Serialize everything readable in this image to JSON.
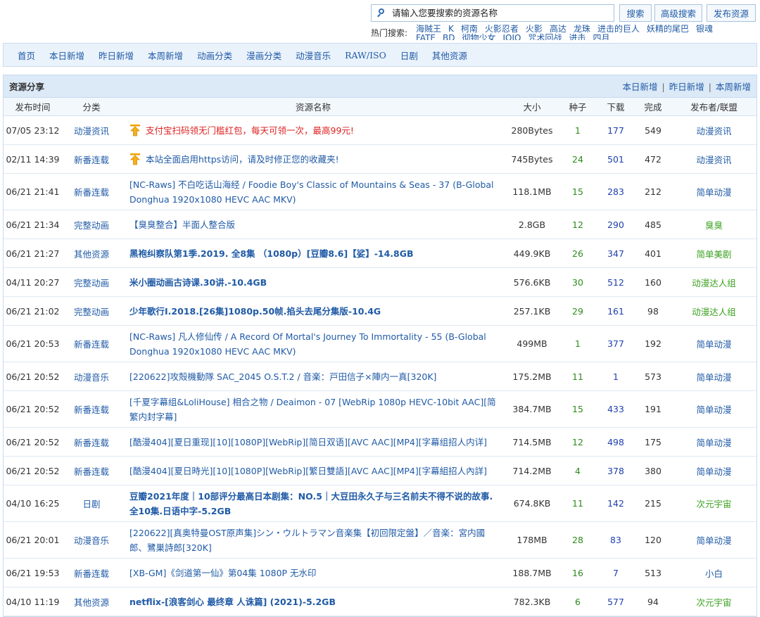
{
  "search": {
    "placeholder": "请输入您要搜索的资源名称",
    "search_btn": "搜索",
    "advanced_btn": "高级搜索",
    "publish_btn": "发布资源"
  },
  "hot": {
    "label": "热门搜索:",
    "keywords": [
      "海贼王",
      "K",
      "柯南",
      "火影忍者",
      "火影",
      "高达",
      "龙珠",
      "进击的巨人",
      "妖精的尾巴",
      "银魂",
      "FATE",
      "BD",
      "彻物少女",
      "JOJO",
      "咒术回战",
      "进击",
      "四月"
    ]
  },
  "nav": {
    "items": [
      "首页",
      "本日新增",
      "昨日新增",
      "本周新增",
      "动画分类",
      "漫画分类",
      "动漫音乐",
      "RAW/ISO",
      "日剧",
      "其他资源"
    ]
  },
  "panel": {
    "title": "资源分享",
    "links": [
      "本日新增",
      "昨日新增",
      "本周新增"
    ],
    "separator": "|",
    "columns": [
      "发布时间",
      "分类",
      "资源名称",
      "大小",
      "种子",
      "下载",
      "完成",
      "发布者/联盟"
    ],
    "rows": [
      {
        "date": "07/05 23:12",
        "category": "动漫资讯",
        "name": "支付宝扫码领无门槛红包，每天可领一次，最高99元!",
        "size": "280Bytes",
        "seeds": "1",
        "downloads": "177",
        "completed": "549",
        "publisher": "动漫资讯"
      },
      {
        "date": "02/11 14:39",
        "category": "新番连载",
        "name": "本站全面启用https访问，请及时修正您的收藏夹!",
        "size": "745Bytes",
        "seeds": "24",
        "downloads": "501",
        "completed": "472",
        "publisher": "动漫资讯"
      },
      {
        "date": "06/21 21:41",
        "category": "新番连载",
        "name": "[NC-Raws] 不白吃话山海经 / Foodie Boy's Classic of Mountains & Seas - 37 (B-Global Donghua 1920x1080 HEVC AAC MKV)",
        "size": "118.1MB",
        "seeds": "15",
        "downloads": "283",
        "completed": "212",
        "publisher": "简单动漫"
      },
      {
        "date": "06/21 21:34",
        "category": "完整动画",
        "name": "【臭臭整合】半面人整合版",
        "size": "2.8GB",
        "seeds": "12",
        "downloads": "290",
        "completed": "485",
        "publisher": "臭臭"
      },
      {
        "date": "06/21 21:27",
        "category": "其他资源",
        "name": "黑袍纠察队第1季.2019. 全8集 （1080p）[豆瓣8.6]【娑】-14.8GB",
        "size": "449.9KB",
        "seeds": "26",
        "downloads": "347",
        "completed": "401",
        "publisher": "简单美剧"
      },
      {
        "date": "04/11 20:27",
        "category": "完整动画",
        "name": "米小圈动画古诗课.30讲.-10.4GB",
        "size": "576.6KB",
        "seeds": "30",
        "downloads": "512",
        "completed": "160",
        "publisher": "动漫达人组"
      },
      {
        "date": "06/21 21:02",
        "category": "完整动画",
        "name": "少年歌行Ⅰ.2018.[26集]1080p.50帧.掐头去尾分集版-10.4G",
        "size": "257.1KB",
        "seeds": "29",
        "downloads": "161",
        "completed": "98",
        "publisher": "动漫达人组"
      },
      {
        "date": "06/21 20:53",
        "category": "新番连载",
        "name": "[NC-Raws] 凡人修仙传 / A Record Of Mortal's Journey To Immortality - 55 (B-Global Donghua 1920x1080 HEVC AAC MKV)",
        "size": "499MB",
        "seeds": "1",
        "downloads": "377",
        "completed": "192",
        "publisher": "简单动漫"
      },
      {
        "date": "06/21 20:52",
        "category": "动漫音乐",
        "name": "[220622]攻殻機動隊 SAC_2045 O.S.T.2 / 音楽：戸田信子×陣内一真[320K]",
        "size": "175.2MB",
        "seeds": "11",
        "downloads": "1",
        "completed": "573",
        "publisher": "简单动漫"
      },
      {
        "date": "06/21 20:52",
        "category": "新番连载",
        "name": "[千夏字幕组&LoliHouse] 相合之物 / Deaimon - 07 [WebRip 1080p HEVC-10bit AAC][简繁内封字幕]",
        "size": "384.7MB",
        "seeds": "15",
        "downloads": "433",
        "completed": "191",
        "publisher": "简单动漫"
      },
      {
        "date": "06/21 20:52",
        "category": "新番连载",
        "name": "[酷漫404][夏日重现][10][1080P][WebRip][简日双语][AVC AAC][MP4][字幕组招人内详]",
        "size": "714.5MB",
        "seeds": "12",
        "downloads": "498",
        "completed": "175",
        "publisher": "简单动漫"
      },
      {
        "date": "06/21 20:52",
        "category": "新番连载",
        "name": "[酷漫404][夏日時光][10][1080P][WebRip][繁日雙語][AVC AAC][MP4][字幕組招人內詳]",
        "size": "714.2MB",
        "seeds": "4",
        "downloads": "378",
        "completed": "380",
        "publisher": "简单动漫"
      },
      {
        "date": "04/10 16:25",
        "category": "日剧",
        "name": "豆瓣2021年度｜10部评分最高日本剧集：NO.5｜大豆田永久子与三名前夫不得不说的故事.全10集.日语中字-5.2GB",
        "size": "674.8KB",
        "seeds": "11",
        "downloads": "142",
        "completed": "215",
        "publisher": "次元宇宙"
      },
      {
        "date": "06/21 20:01",
        "category": "动漫音乐",
        "name": "[220622][真奥特曼OST原声集]シン・ウルトラマン音楽集【初回限定盤】／音楽：宮内國郎、鷺巣詩郎[320K]",
        "size": "178MB",
        "seeds": "28",
        "downloads": "83",
        "completed": "120",
        "publisher": "简单动漫"
      },
      {
        "date": "06/21 19:53",
        "category": "新番连载",
        "name": "[XB-GM]《剑道第一仙》第04集 1080P 无水印",
        "size": "188.7MB",
        "seeds": "16",
        "downloads": "7",
        "completed": "513",
        "publisher": "小白"
      },
      {
        "date": "04/10 11:19",
        "category": "其他资源",
        "name": "netflix-[浪客剑心 最终章 人诛篇] (2021)-5.2GB",
        "size": "782.3KB",
        "seeds": "6",
        "downloads": "577",
        "completed": "94",
        "publisher": "次元宇宙"
      }
    ]
  },
  "colors": {
    "link": "#1f5aa6",
    "seeds": "#2c8a1a",
    "downloads": "#1f3faf",
    "pinned_red": "#e02020",
    "publisher_green": "#3aa11e",
    "nav_bg": "#eaf2fb"
  }
}
